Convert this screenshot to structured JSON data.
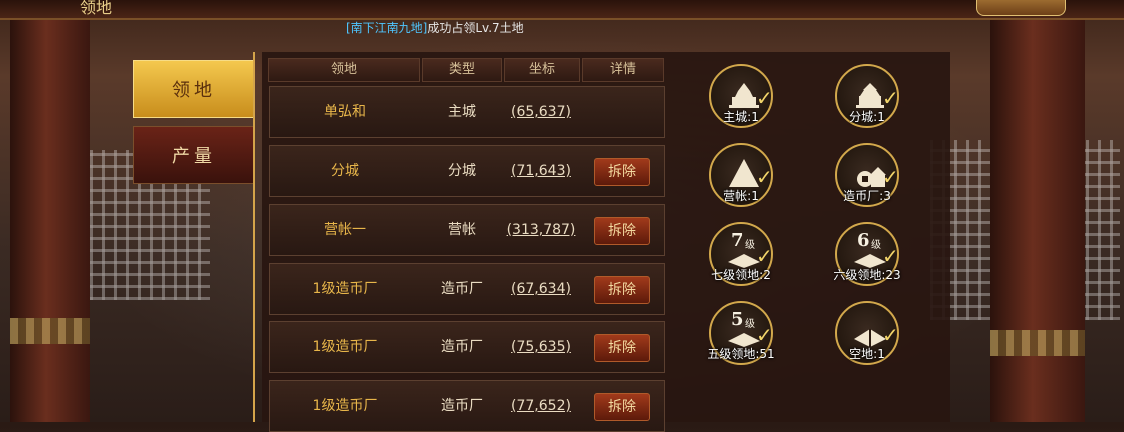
{
  "top": {
    "title": "领地",
    "notice_link": "[南下江南九地]",
    "notice_text": "成功占领Lv.7土地"
  },
  "tabs": [
    {
      "label": "领地",
      "active": true
    },
    {
      "label": "产量",
      "active": false
    }
  ],
  "table": {
    "headers": [
      "领地",
      "类型",
      "坐标",
      "详情"
    ],
    "rows": [
      {
        "name": "单弘和",
        "type": "主城",
        "coord": "(65,637)",
        "action": ""
      },
      {
        "name": "分城",
        "type": "分城",
        "coord": "(71,643)",
        "action": "拆除"
      },
      {
        "name": "营帐一",
        "type": "营帐",
        "coord": "(313,787)",
        "action": "拆除"
      },
      {
        "name": "1级造币厂",
        "type": "造币厂",
        "coord": "(67,634)",
        "action": "拆除"
      },
      {
        "name": "1级造币厂",
        "type": "造币厂",
        "coord": "(75,635)",
        "action": "拆除"
      },
      {
        "name": "1级造币厂",
        "type": "造币厂",
        "coord": "(77,652)",
        "action": "拆除"
      }
    ]
  },
  "summary": [
    {
      "icon": "main-city-icon",
      "label": "主城:1"
    },
    {
      "icon": "branch-city-icon",
      "label": "分城:1"
    },
    {
      "icon": "camp-tent-icon",
      "label": "营帐:1"
    },
    {
      "icon": "mint-icon",
      "label": "造币厂:3"
    },
    {
      "icon": "level7-land-icon",
      "level": "7",
      "level_suffix": "级",
      "label": "七级领地:2"
    },
    {
      "icon": "level6-land-icon",
      "level": "6",
      "level_suffix": "级",
      "label": "六级领地:23"
    },
    {
      "icon": "level5-land-icon",
      "level": "5",
      "level_suffix": "级",
      "label": "五级领地:51"
    },
    {
      "icon": "empty-land-icon",
      "label": "空地:1"
    }
  ],
  "colors": {
    "accent_gold": "#e8b64a",
    "link_blue": "#4fc6ff",
    "demolish_red": "#a13a1b"
  }
}
